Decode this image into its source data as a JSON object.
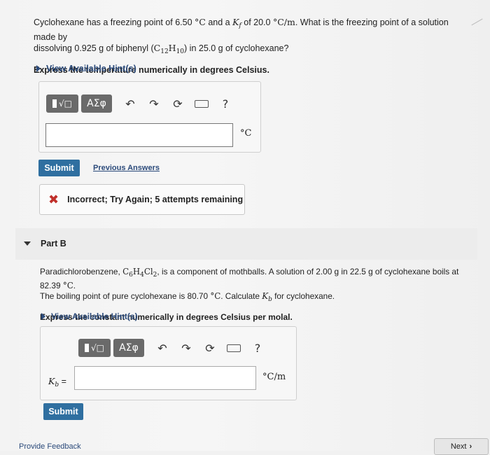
{
  "part_a": {
    "q_line1_pre": "Cyclohexane has a freezing point of 6.50 ",
    "q_deg": "°C",
    "q_and": " and a ",
    "q_kf_sym": "K",
    "q_kf_sub": "f",
    "q_of": " of 20.0 ",
    "q_kf_unit": "°C/m",
    "q_line1_post": ". What is the freezing point of a solution made by",
    "q_line2_pre": "dissolving 0.925 g of biphenyl (",
    "q_c": "C",
    "q_c_sub": "12",
    "q_h": "H",
    "q_h_sub": "10",
    "q_line2_post": ") in 25.0 g of cyclohexane?",
    "instruction": "Express the temperature numerically in degrees Celsius.",
    "hint": "View Available Hint(s)",
    "answer_value": "",
    "unit": "°C",
    "submit": "Submit",
    "previous": "Previous Answers",
    "feedback": "Incorrect; Try Again; 5 attempts remaining"
  },
  "toolbar": {
    "template_label": "√□",
    "greek_label": "ΑΣφ",
    "help": "?"
  },
  "part_b": {
    "label": "Part B",
    "t1_pre": "Paradichlorobenzene, ",
    "f_c": "C",
    "f_c_sub": "6",
    "f_h": "H",
    "f_h_sub": "4",
    "f_cl": "Cl",
    "f_cl_sub": "2",
    "t1_post": ", is a component of mothballs. A solution of 2.00 g in 22.5 g of cyclohexane boils at 82.39 ",
    "deg": "°C",
    "dot": ".",
    "t2_pre": "The boiling point of pure cyclohexane is 80.70 ",
    "t2_mid": ". Calculate ",
    "kb_sym": "K",
    "kb_sub": "b",
    "t2_post": " for cyclohexane.",
    "instruction": "Express the constant numerically in degrees Celsius per molal.",
    "hint": "View Available Hint(s)",
    "var_label": "K",
    "var_sub": "b",
    "var_eq": " =",
    "answer_value": "",
    "unit": "°C/m",
    "submit": "Submit"
  },
  "footer": {
    "feedback_link": "Provide Feedback",
    "next": "Next",
    "next_icon": "chevron-right-icon"
  }
}
